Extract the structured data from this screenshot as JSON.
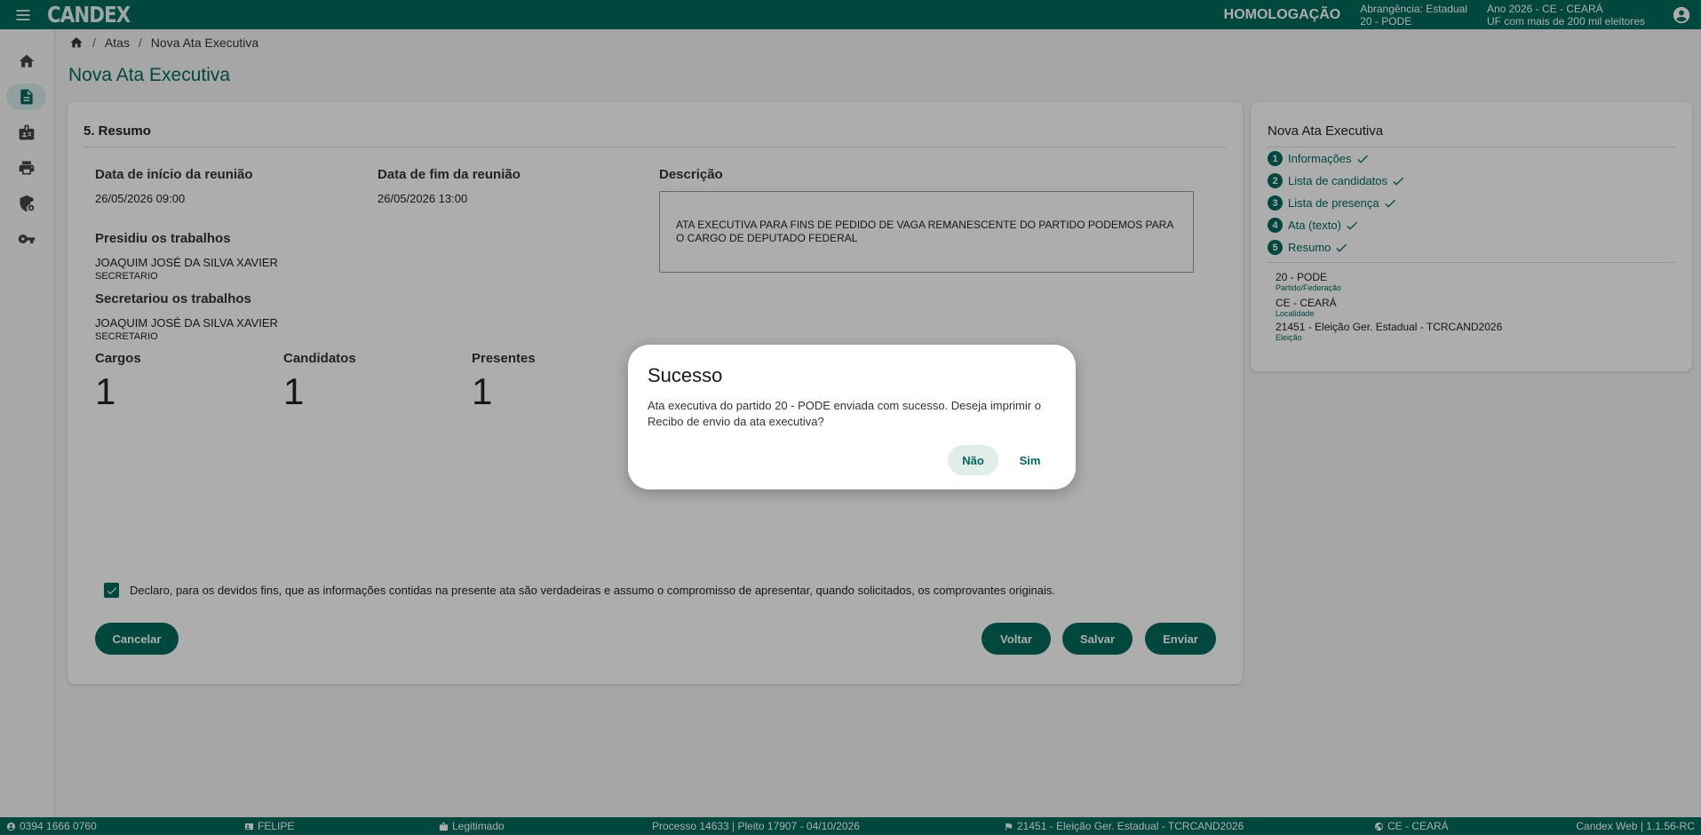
{
  "topbar": {
    "logo": "CANDEX",
    "environment": "HOMOLOGAÇÃO",
    "scope_line1": "Abrangência: Estadual",
    "scope_line2": "20 - PODE",
    "year_line1": "Ano 2026 - CE - CEARÁ",
    "year_line2": "UF com mais de 200 mil eleitores"
  },
  "sidebar": {
    "items": [
      {
        "icon": "home-icon"
      },
      {
        "icon": "document-icon"
      },
      {
        "icon": "id-badge-icon"
      },
      {
        "icon": "printer-icon"
      },
      {
        "icon": "shield-lock-icon"
      },
      {
        "icon": "key-icon"
      }
    ]
  },
  "breadcrumb": {
    "items": [
      "Atas",
      "Nova Ata Executiva"
    ]
  },
  "page_title": "Nova Ata Executiva",
  "summary": {
    "section_title": "5. Resumo",
    "start_label": "Data de início da reunião",
    "start_value": "26/05/2026 09:00",
    "end_label": "Data de fim da reunião",
    "end_value": "26/05/2026 13:00",
    "description_label": "Descrição",
    "description_value": "ATA EXECUTIVA PARA FINS DE PEDIDO DE VAGA REMANESCENTE DO PARTIDO PODEMOS PARA O CARGO DE DEPUTADO FEDERAL",
    "presided_label": "Presidiu os trabalhos",
    "presided_name": "JOAQUIM JOSÉ DA SILVA XAVIER",
    "presided_role": "SECRETARIO",
    "secretary_label": "Secretariou os trabalhos",
    "secretary_name": "JOAQUIM JOSÉ DA SILVA XAVIER",
    "secretary_role": "SECRETARIO",
    "cargos_label": "Cargos",
    "cargos_value": "1",
    "candidatos_label": "Candidatos",
    "candidatos_value": "1",
    "presentes_label": "Presentes",
    "presentes_value": "1",
    "declaration": "Declaro, para os devidos fins, que as informações contidas na presente ata são verdadeiras e assumo o compromisso de apresentar, quando solicitados, os comprovantes originais.",
    "declaration_checked": true
  },
  "buttons": {
    "cancel": "Cancelar",
    "back": "Voltar",
    "save": "Salvar",
    "send": "Enviar"
  },
  "side_panel": {
    "title": "Nova Ata Executiva",
    "steps": [
      {
        "num": "1",
        "label": "Informações"
      },
      {
        "num": "2",
        "label": "Lista de candidatos"
      },
      {
        "num": "3",
        "label": "Lista de presença"
      },
      {
        "num": "4",
        "label": "Ata (texto)"
      },
      {
        "num": "5",
        "label": "Resumo"
      }
    ],
    "party_value": "20 - PODE",
    "party_label": "Partido/Federação",
    "locality_value": "CE - CEARÁ",
    "locality_label": "Localidade",
    "election_value": "21451 - Eleição Ger. Estadual - TCRCAND2026",
    "election_label": "Eleição"
  },
  "dialog": {
    "title": "Sucesso",
    "message": "Ata executiva do partido 20 - PODE enviada com sucesso. Deseja imprimir o Recibo de envio da ata executiva?",
    "no_label": "Não",
    "yes_label": "Sim"
  },
  "footer": {
    "phone": "0394 1666 0760",
    "user": "FELIPE",
    "status": "Legitimado",
    "process": "Processo 14633 | Pleito 17907 - 04/10/2026",
    "election": "21451 - Eleição Ger. Estadual - TCRCAND2026",
    "locality": "CE - CEARÁ",
    "version": "Candex Web | 1.1.56-RC"
  },
  "colors": {
    "primary": "#00695c",
    "sidebar_active": "#d7eeea",
    "overlay": "rgba(0,0,0,0.32)"
  }
}
